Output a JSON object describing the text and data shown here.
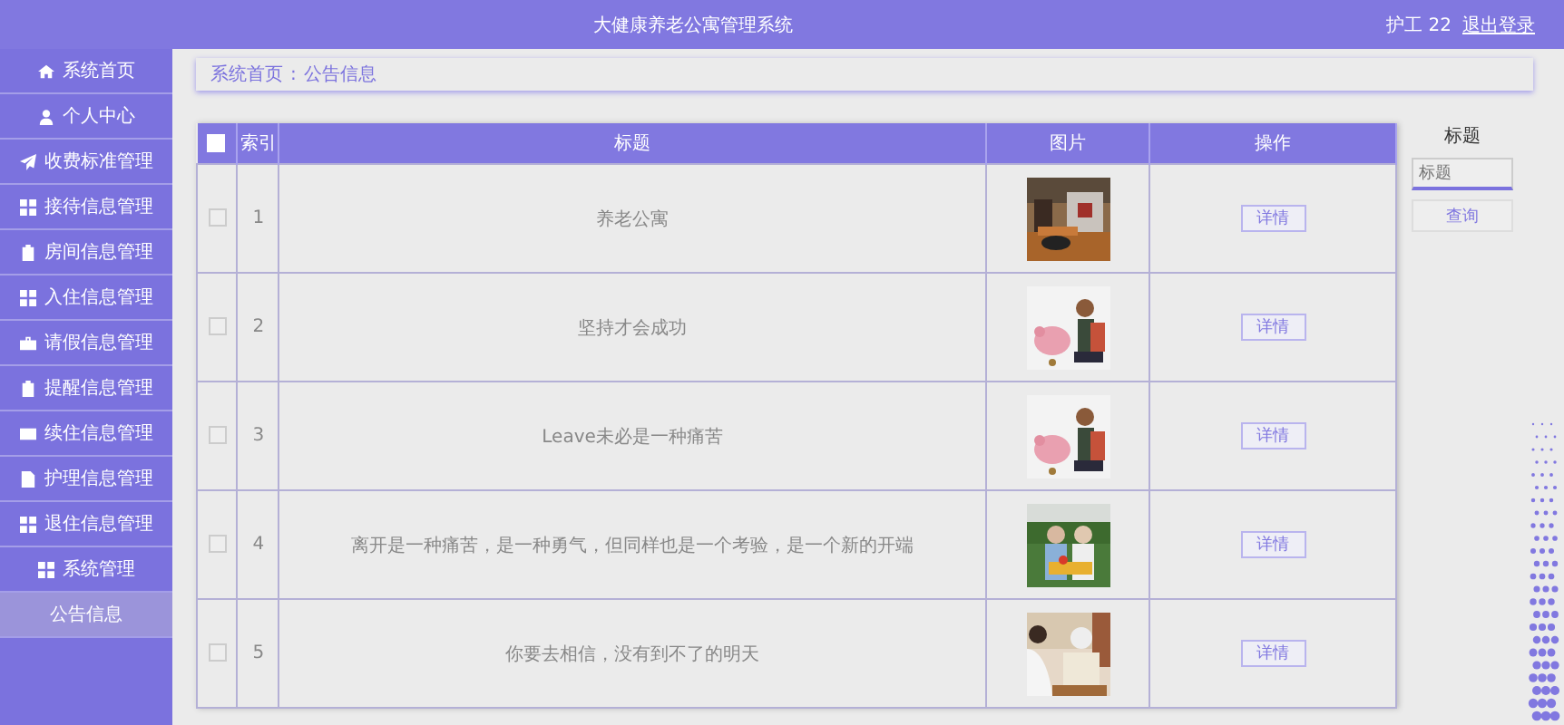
{
  "header": {
    "title": "大健康养老公寓管理系统",
    "user": "护工 22",
    "logout": "退出登录"
  },
  "sidebar": {
    "items": [
      {
        "label": "系统首页",
        "selected": false
      },
      {
        "label": "个人中心",
        "selected": false
      },
      {
        "label": "收费标准管理",
        "selected": false
      },
      {
        "label": "接待信息管理",
        "selected": false
      },
      {
        "label": "房间信息管理",
        "selected": false
      },
      {
        "label": "入住信息管理",
        "selected": false
      },
      {
        "label": "请假信息管理",
        "selected": false
      },
      {
        "label": "提醒信息管理",
        "selected": false
      },
      {
        "label": "续住信息管理",
        "selected": false
      },
      {
        "label": "护理信息管理",
        "selected": false
      },
      {
        "label": "退住信息管理",
        "selected": false
      },
      {
        "label": "系统管理",
        "selected": false
      },
      {
        "label": "公告信息",
        "selected": true
      }
    ]
  },
  "breadcrumb": [
    "系统首页",
    ":",
    "公告信息"
  ],
  "table": {
    "select_all_checked": false,
    "columns": [
      "索引",
      "标题",
      "图片",
      "操作"
    ],
    "rows": [
      {
        "checked": false,
        "index": "1",
        "title": "养老公寓",
        "action": "详情"
      },
      {
        "checked": false,
        "index": "2",
        "title": "坚持才会成功",
        "action": "详情"
      },
      {
        "checked": false,
        "index": "3",
        "title": "Leave未必是一种痛苦",
        "action": "详情"
      },
      {
        "checked": false,
        "index": "4",
        "title": "离开是一种痛苦，是一种勇气，但同样也是一个考验，是一个新的开端",
        "action": "详情"
      },
      {
        "checked": false,
        "index": "5",
        "title": "你要去相信，没有到不了的明天",
        "action": "详情"
      }
    ]
  },
  "search": {
    "label": "标题",
    "placeholder": "标题",
    "button": "查询"
  }
}
